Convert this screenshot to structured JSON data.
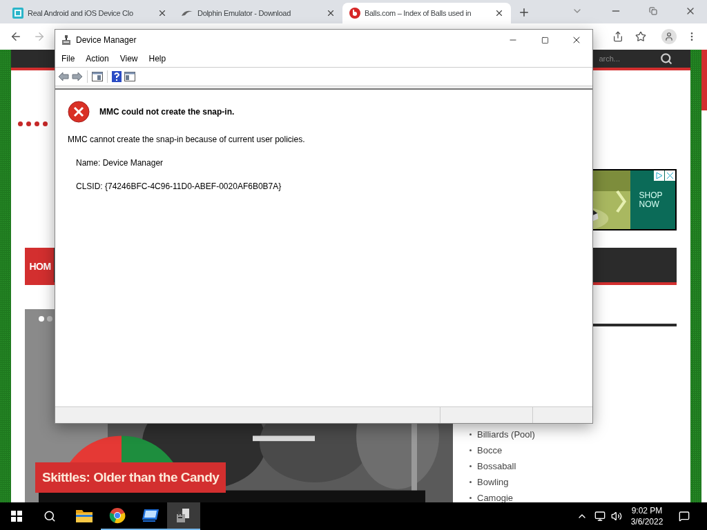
{
  "browser": {
    "tabs": [
      {
        "title": "Real Android and iOS Device Clo",
        "selected": false
      },
      {
        "title": "Dolphin Emulator - Download",
        "selected": false
      },
      {
        "title": "Balls.com – Index of Balls used in",
        "selected": true
      }
    ]
  },
  "website": {
    "search_placeholder": "arch...",
    "nav_item": "HOM",
    "ad_cta": "SHOP NOW",
    "slides": [
      {
        "selected": true
      },
      {
        "selected": false
      }
    ],
    "caption": "Skittles: Older than the Candy",
    "sports": [
      "Billiards (Pool)",
      "Bocce",
      "Bossaball",
      "Bowling",
      "Camogie"
    ]
  },
  "dialog": {
    "title": "Device Manager",
    "menu": [
      "File",
      "Action",
      "View",
      "Help"
    ],
    "error_title": "MMC could not create the snap-in.",
    "message": "MMC cannot create the snap-in because of current user policies.",
    "details": [
      "Name: Device Manager",
      "CLSID: {74246BFC-4C96-11D0-ABEF-0020AF6B0B7A}"
    ]
  },
  "taskbar": {
    "apps": [
      {
        "kind": "explorer",
        "running": false,
        "selected": false
      },
      {
        "kind": "chrome",
        "running": true,
        "selected": false
      },
      {
        "kind": "remote",
        "running": true,
        "selected": false
      },
      {
        "kind": "devices",
        "running": true,
        "selected": true
      }
    ],
    "time": "9:02 PM",
    "date": "3/6/2022"
  }
}
